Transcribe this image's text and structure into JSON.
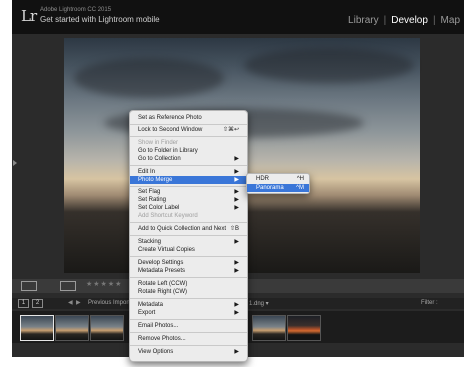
{
  "app": {
    "name": "Adobe Lightroom CC 2015",
    "logo_text": "Lr",
    "subtitle": "Get started with Lightroom mobile"
  },
  "modules": [
    {
      "label": "Library",
      "active": false
    },
    {
      "label": "Develop",
      "active": true
    },
    {
      "label": "Map",
      "active": false
    }
  ],
  "toolbar": {
    "stars": "★★★★★"
  },
  "filmstrip_bar": {
    "page1": "1",
    "page2": "2",
    "previous_import": "Previous Import",
    "file_suffix": "1.dng ▾",
    "filter_label": "Filter :"
  },
  "context_menu": {
    "items": [
      {
        "label": "Set as Reference Photo",
        "shortcut": "",
        "arrow": false,
        "disabled": false
      },
      {
        "label": "Lock to Second Window",
        "shortcut": "⇧⌘↩",
        "arrow": false,
        "disabled": false
      },
      {
        "label": "Show in Finder",
        "shortcut": "",
        "arrow": false,
        "disabled": true
      },
      {
        "label": "Go to Folder in Library",
        "shortcut": "",
        "arrow": false,
        "disabled": false
      },
      {
        "label": "Go to Collection",
        "shortcut": "",
        "arrow": true,
        "disabled": false
      },
      {
        "label": "Edit In",
        "shortcut": "",
        "arrow": true,
        "disabled": false
      },
      {
        "label": "Photo Merge",
        "shortcut": "",
        "arrow": true,
        "disabled": false,
        "highlighted": true
      },
      {
        "label": "Set Flag",
        "shortcut": "",
        "arrow": true,
        "disabled": false
      },
      {
        "label": "Set Rating",
        "shortcut": "",
        "arrow": true,
        "disabled": false
      },
      {
        "label": "Set Color Label",
        "shortcut": "",
        "arrow": true,
        "disabled": false
      },
      {
        "label": "Add Shortcut Keyword",
        "shortcut": "",
        "arrow": false,
        "disabled": true
      },
      {
        "label": "Add to Quick Collection and Next",
        "shortcut": "⇧B",
        "arrow": false,
        "disabled": false
      },
      {
        "label": "Stacking",
        "shortcut": "",
        "arrow": true,
        "disabled": false
      },
      {
        "label": "Create Virtual Copies",
        "shortcut": "",
        "arrow": false,
        "disabled": false
      },
      {
        "label": "Develop Settings",
        "shortcut": "",
        "arrow": true,
        "disabled": false
      },
      {
        "label": "Metadata Presets",
        "shortcut": "",
        "arrow": true,
        "disabled": false
      },
      {
        "label": "Rotate Left (CCW)",
        "shortcut": "",
        "arrow": false,
        "disabled": false
      },
      {
        "label": "Rotate Right (CW)",
        "shortcut": "",
        "arrow": false,
        "disabled": false
      },
      {
        "label": "Metadata",
        "shortcut": "",
        "arrow": true,
        "disabled": false
      },
      {
        "label": "Export",
        "shortcut": "",
        "arrow": true,
        "disabled": false
      },
      {
        "label": "Email Photos...",
        "shortcut": "",
        "arrow": false,
        "disabled": false
      },
      {
        "label": "Remove Photos...",
        "shortcut": "",
        "arrow": false,
        "disabled": false
      },
      {
        "label": "View Options",
        "shortcut": "",
        "arrow": true,
        "disabled": false
      }
    ]
  },
  "photo_merge_submenu": {
    "items": [
      {
        "label": "HDR",
        "shortcut": "^H"
      },
      {
        "label": "Panorama",
        "shortcut": "^M",
        "highlighted": true
      }
    ]
  },
  "colors": {
    "highlight": "#3a76d8",
    "menu_bg": "#ececec",
    "topbar": "#111111"
  }
}
